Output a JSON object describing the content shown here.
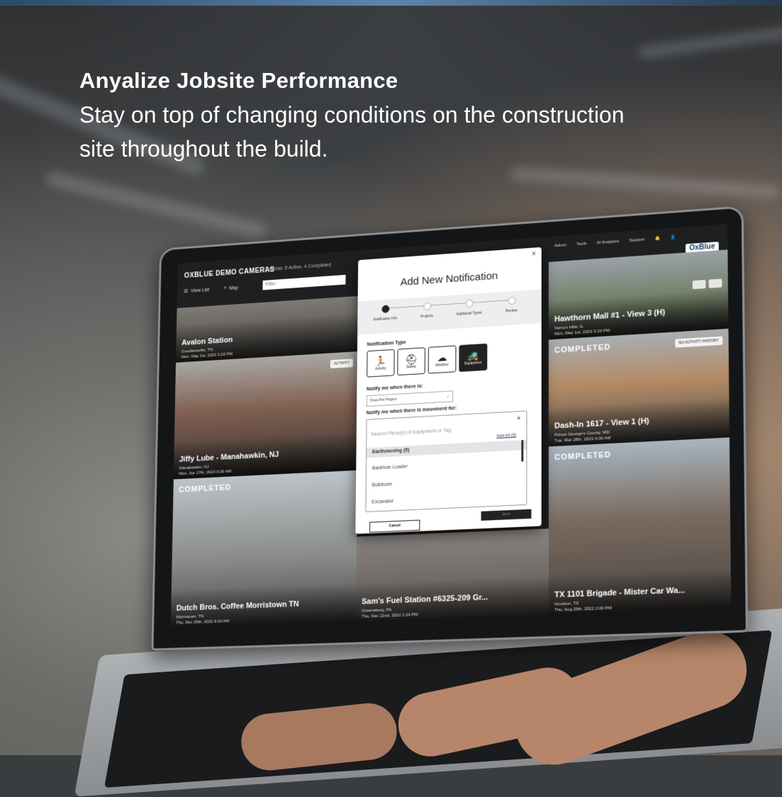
{
  "headline": {
    "title": "Anyalize Jobsite Performance",
    "subtitle": "Stay on top of changing conditions on the construction site throughout the build."
  },
  "app": {
    "title": "OXBLUE DEMO CAMERAS",
    "camera_count": "Cameras: 5 Active, 4 Completed",
    "view_list": "View List",
    "map": "Map",
    "filter": "Filter",
    "nav": [
      "Admin",
      "Tools",
      "AI Analytics",
      "Support"
    ],
    "logo": "OxBlue"
  },
  "tiles": [
    {
      "name": "Avalon Station",
      "loc": "Goodlettsville, TN",
      "date": "Mon, May 1st, 2023 3:20 PM"
    },
    {
      "name": "Jiffy Lube - Manahawkin, NJ",
      "loc": "Manahawkin, NJ",
      "date": "Mon, Apr 17th, 2023 9:20 AM",
      "badge": "ACTIVITY"
    },
    {
      "name": "Dutch Bros. Coffee Morristown TN",
      "loc": "Morristown, TN",
      "date": "Thu, Dec 29th, 2022 9:20 AM",
      "status": "COMPLETED"
    },
    {
      "name": "Sam's Fuel Station #6325-209 Gr...",
      "loc": "Greensburg, PA",
      "date": "Thu, Dec 22nd, 2022 1:24 PM"
    },
    {
      "name": "Hawthorn Mall #1 - View 3 (H)",
      "loc": "Vernon Hills, IL",
      "date": "Mon, May 1st, 2023 3:20 PM"
    },
    {
      "name": "Dash-In 1617 - View 1 (H)",
      "loc": "Prince George's County, MD",
      "date": "Tue, Mar 28th, 2023 4:00 AM",
      "status": "COMPLETED",
      "badge": "NO ACTIVITY HISTORY"
    },
    {
      "name": "TX 1101 Brigade - Mister Car Wa...",
      "loc": "Houston, TX",
      "date": "Thu, Aug 25th, 2022 2:00 PM",
      "status": "COMPLETED"
    }
  ],
  "modal": {
    "title": "Add New Notification",
    "steps": [
      "Notification Info",
      "Projects",
      "Additional Types",
      "Review"
    ],
    "type_label": "Notification Type",
    "types": [
      {
        "label": "Activity",
        "icon": "running-person-icon"
      },
      {
        "label": "Safety",
        "icon": "worker-icon"
      },
      {
        "label": "Weather",
        "icon": "cloud-icon"
      },
      {
        "label": "Equipment",
        "icon": "forklift-icon"
      }
    ],
    "notify_label": "Notify me when there is:",
    "notify_value": "Once Per Project",
    "movement_label": "Notify me when there is movement for:",
    "search_placeholder": "Search Piece(s) of Equipment or Tag",
    "add_all": "Add All (5)",
    "group": "Earthmoving (5)",
    "items": [
      "Backhoe Loader",
      "Bulldozer",
      "Excavator"
    ],
    "cancel": "Cancel",
    "next": "Next"
  }
}
